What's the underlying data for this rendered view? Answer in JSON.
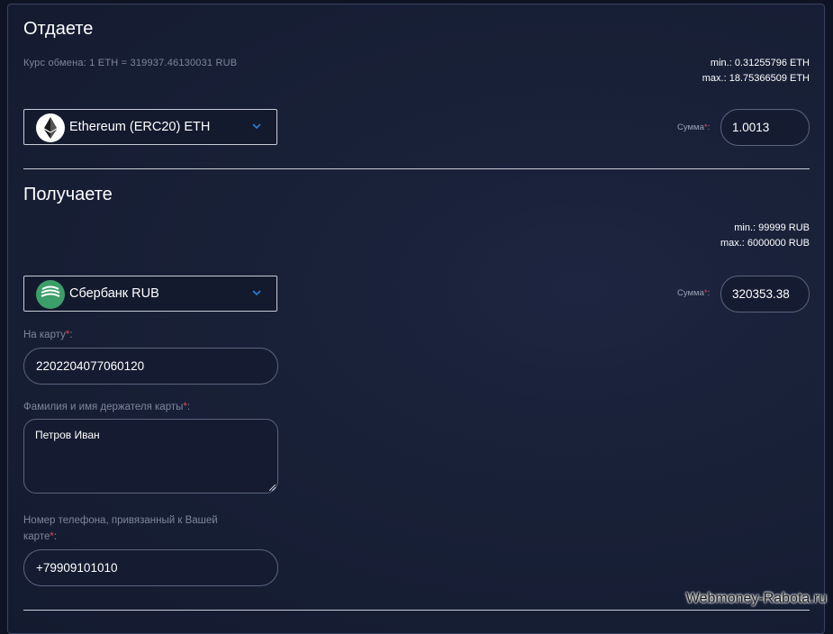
{
  "give": {
    "title": "Отдаете",
    "rate": "Курс обмена: 1 ETH = 319937.46130031 RUB",
    "min": "min.: 0.31255796 ETH",
    "max": "max.: 18.75366509 ETH",
    "currency": {
      "label": "Ethereum (ERC20) ETH",
      "icon": "ethereum-icon"
    },
    "sum_label": "Сумма",
    "required_mark": "*",
    "colon": ":",
    "sum_value": "1.0013"
  },
  "receive": {
    "title": "Получаете",
    "min": "min.: 99999 RUB",
    "max": "max.: 6000000 RUB",
    "currency": {
      "label": "Сбербанк RUB",
      "icon": "sberbank-icon"
    },
    "sum_label": "Сумма",
    "required_mark": "*",
    "colon": ":",
    "sum_value": "320353.38",
    "card_label": "На карту",
    "card_value": "2202204077060120",
    "holder_label": "Фамилия и имя держателя карты",
    "holder_value": "Петров Иван",
    "phone_label_line1": "Номер телефона, привязанный к Вашей",
    "phone_label_line2": "карте",
    "phone_value": "+79909101010"
  },
  "watermark": "Webmoney-Rabota.ru",
  "colors": {
    "background": "#182037",
    "border": "#c8ccd6",
    "required": "#e04848",
    "sber_green": "#3c9e68",
    "chevron": "#2f7fd8"
  }
}
